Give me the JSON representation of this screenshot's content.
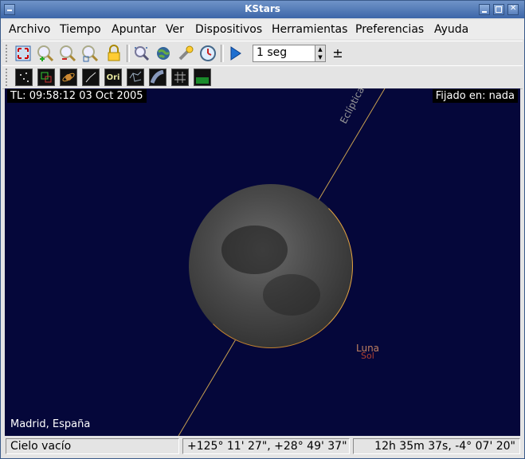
{
  "window": {
    "title": "KStars"
  },
  "menu": [
    "Archivo",
    "Tiempo",
    "Apuntar",
    "Ver",
    "Dispositivos",
    "Herramientas",
    "Preferencias",
    "Ayuda"
  ],
  "toolbar1": {
    "icons": [
      "zoom-fit-icon",
      "zoom-in-icon",
      "zoom-out-icon",
      "zoom-default-icon",
      "lock-icon",
      "find-object-icon",
      "globe-icon",
      "tools-icon",
      "clock-icon",
      "play-icon"
    ],
    "time_step": "1 seg",
    "time_step_pm": "±"
  },
  "toolbar2": {
    "icons": [
      "stars-icon",
      "deep-sky-icon",
      "solar-system-icon",
      "constellation-lines-icon",
      "constellation-names-icon",
      "constellation-boundaries-icon",
      "milky-way-icon",
      "coordinate-grid-icon",
      "horizon-icon"
    ],
    "ori_label": "Ori"
  },
  "sky": {
    "time": "TL: 09:58:12   03 Oct 2005",
    "focus": "Fijado en: nada",
    "location": "Madrid, España",
    "ecliptic_label": "Eclíptica",
    "objects": [
      "Luna",
      "Sol"
    ]
  },
  "status": {
    "focus_text": "Cielo vacío",
    "altaz": "+125° 11' 27\",  +28° 49' 37\"",
    "radec": "12h 35m 37s,  -4° 07' 20\""
  },
  "colors": {
    "sky": "#05073a",
    "titlebar": "#4a72b0",
    "moon_rim": "#e0a040",
    "ecliptic": "#c8a050"
  }
}
